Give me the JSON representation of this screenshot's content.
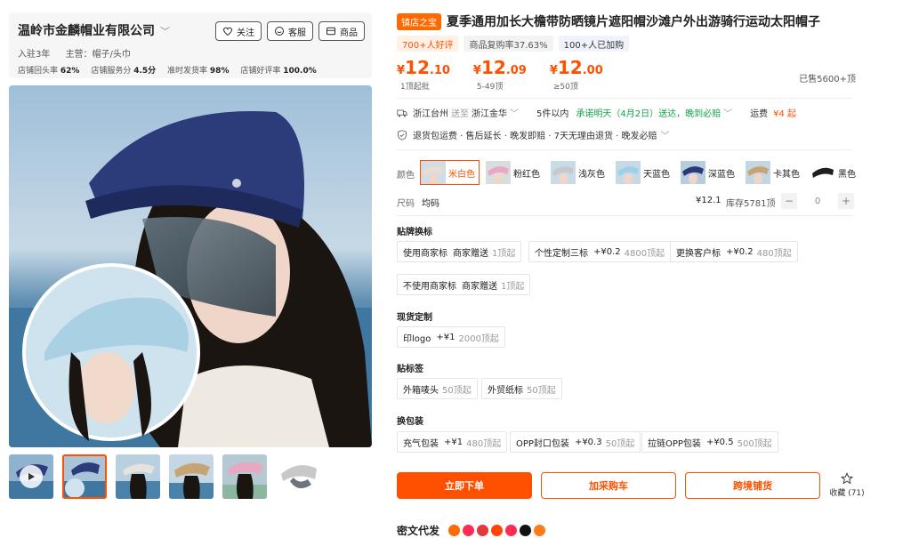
{
  "shop": {
    "name": "温岭市金麟帽业有限公司",
    "years": "入驻3年",
    "main_business": "主营：帽子/头巾",
    "stats": [
      {
        "label": "店铺回头率",
        "value": "62%"
      },
      {
        "label": "店铺服务分",
        "value": "4.5分"
      },
      {
        "label": "准时发货率",
        "value": "98%"
      },
      {
        "label": "店铺好评率",
        "value": "100.0%"
      }
    ],
    "buttons": {
      "follow": "关注",
      "service": "客服",
      "products": "商品"
    }
  },
  "product": {
    "badge": "镇店之宝",
    "title": "夏季通用加长大檐带防晒镜片遮阳帽沙滩户外出游骑行运动太阳帽子",
    "tags": [
      "700+人好评",
      "商品复购率37.63%",
      "100+人已加购"
    ],
    "prices": [
      {
        "currency": "¥",
        "int": "12",
        "dec": ".10",
        "cond": "1顶起批"
      },
      {
        "currency": "¥",
        "int": "12",
        "dec": ".09",
        "cond": "5-49顶"
      },
      {
        "currency": "¥",
        "int": "12",
        "dec": ".00",
        "cond": "≥50顶"
      }
    ],
    "sold": "已售5600+顶"
  },
  "shipping": {
    "from": "浙江台州",
    "to_word": "送至",
    "to": "浙江金华",
    "qty": "5件以内",
    "promise": "承诺明天（4月2日）送达，晚到必赔",
    "fee_label": "运费",
    "fee": "¥4 起"
  },
  "services": "退货包运费 · 售后延长 · 晚发即赔 · 7天无理由退货 · 晚发必赔",
  "colors": {
    "label": "颜色",
    "items": [
      {
        "name": "米白色",
        "hex": "#e8ddd0"
      },
      {
        "name": "粉红色",
        "hex": "#e9a8c2"
      },
      {
        "name": "浅灰色",
        "hex": "#c8c8c8"
      },
      {
        "name": "天蓝色",
        "hex": "#9fd0ea"
      },
      {
        "name": "深蓝色",
        "hex": "#283a7a"
      },
      {
        "name": "卡其色",
        "hex": "#c6a474"
      },
      {
        "name": "黑色",
        "hex": "#1e1e1e"
      }
    ]
  },
  "size": {
    "label": "尺码",
    "value": "均码",
    "price": "¥12.1",
    "stock": "库存5781顶",
    "qty": "0",
    "minus": "−",
    "plus": "+"
  },
  "sections": {
    "label_custom": {
      "title": "贴牌换标",
      "options": [
        {
          "name": "使用商家标",
          "extra": "商家赠送",
          "min": "1顶起"
        },
        {
          "name": "个性定制三标",
          "extra": "+¥0.2",
          "min": "4800顶起"
        },
        {
          "name": "更换客户标",
          "extra": "+¥0.2",
          "min": "480顶起"
        },
        {
          "name": "不使用商家标",
          "extra": "商家赠送",
          "min": "1顶起"
        }
      ]
    },
    "stock_custom": {
      "title": "现货定制",
      "options": [
        {
          "name": "印logo",
          "extra": "+¥1",
          "min": "2000顶起"
        }
      ]
    },
    "sticker": {
      "title": "贴标签",
      "options": [
        {
          "name": "外箱唛头",
          "extra": "",
          "min": "50顶起"
        },
        {
          "name": "外贸纸标",
          "extra": "",
          "min": "50顶起"
        }
      ]
    },
    "packaging": {
      "title": "换包装",
      "options": [
        {
          "name": "充气包装",
          "extra": "+¥1",
          "min": "480顶起"
        },
        {
          "name": "OPP封口包装",
          "extra": "+¥0.3",
          "min": "50顶起"
        },
        {
          "name": "拉链OPP包装",
          "extra": "+¥0.5",
          "min": "500顶起"
        }
      ]
    }
  },
  "actions": {
    "buy": "立即下单",
    "cart": "加采购车",
    "cross": "跨境铺货",
    "fav": "收藏 (71)"
  },
  "distribution": {
    "title": "密文代发"
  },
  "accent": "#ff5000"
}
